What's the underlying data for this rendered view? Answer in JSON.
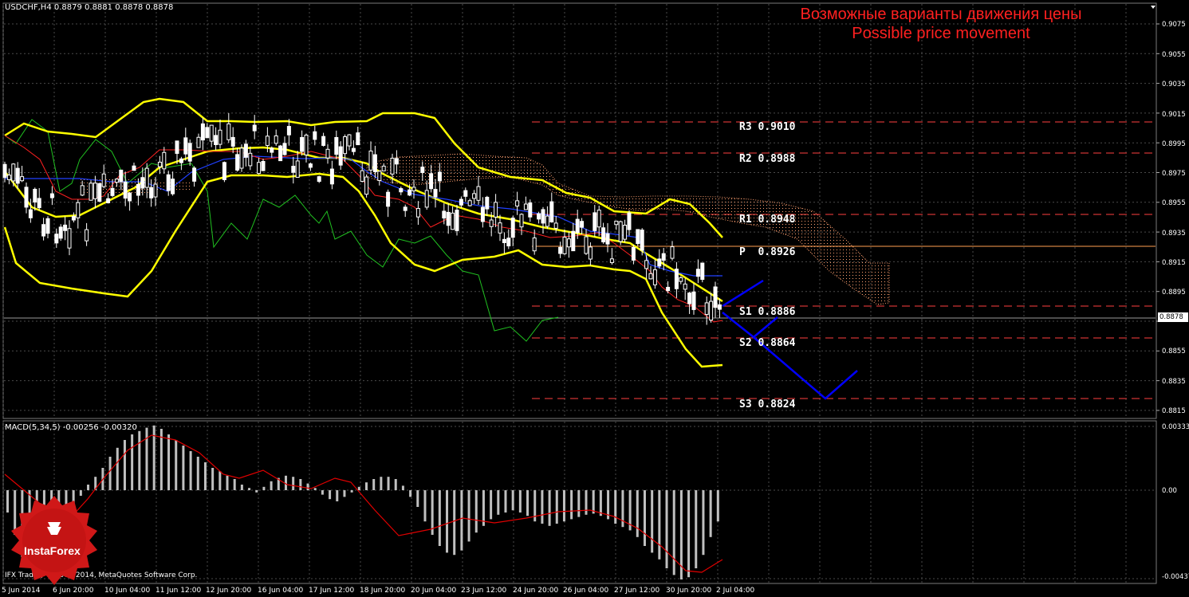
{
  "window": {
    "symbol_line": "USDCHF,H4  0.8879 0.8881 0.8878 0.8878",
    "banner_ru": "Возможные варианты движения цены",
    "banner_en": "Possible price movement",
    "macd_line": "MACD(5,34,5) -0.00256 -0.00320",
    "copyright": "IFX Trader, © 2001-2014, MetaQuotes Software Corp.",
    "logo_text": "InstaForex",
    "current_price": "0.8878"
  },
  "price_axis": [
    "0.9075",
    "0.9055",
    "0.9035",
    "0.9015",
    "0.8995",
    "0.8975",
    "0.8955",
    "0.8935",
    "0.8915",
    "0.8895",
    "0.8875",
    "0.8855",
    "0.8835",
    "0.8815"
  ],
  "macd_axis": [
    "0.00333",
    "0.00",
    "-0.00437"
  ],
  "date_axis": [
    "5 Jun 2014",
    "6 Jun 20:00",
    "10 Jun 04:00",
    "11 Jun 12:00",
    "12 Jun 20:00",
    "16 Jun 04:00",
    "17 Jun 12:00",
    "18 Jun 20:00",
    "20 Jun 04:00",
    "23 Jun 12:00",
    "24 Jun 20:00",
    "26 Jun 04:00",
    "27 Jun 12:00",
    "30 Jun 20:00",
    "2 Jul 04:00"
  ],
  "pivots": [
    {
      "label": "R3",
      "value": "0.9010",
      "color": "#ff4040",
      "style": "dashed"
    },
    {
      "label": "R2",
      "value": "0.8988",
      "color": "#ff4040",
      "style": "dashed"
    },
    {
      "label": "R1",
      "value": "0.8948",
      "color": "#ff4040",
      "style": "dashed"
    },
    {
      "label": "P",
      "value": "0.8926",
      "color": "#ffa050",
      "style": "solid"
    },
    {
      "label": "S1",
      "value": "0.8886",
      "color": "#ff4040",
      "style": "dashed"
    },
    {
      "label": "S2",
      "value": "0.8864",
      "color": "#ff4040",
      "style": "dashed"
    },
    {
      "label": "S3",
      "value": "0.8824",
      "color": "#ff4040",
      "style": "dashed"
    }
  ],
  "colors": {
    "background": "#000000",
    "grid": "#4a4a4a",
    "bollinger": "#ffff00",
    "tenkan": "#ff2020",
    "kijun": "#2040ff",
    "chikou": "#20c020",
    "kumo": "#ffa070",
    "forecast": "#0000ff",
    "candle": "#ffffff",
    "macd_hist": "#c0c0c0",
    "macd_signal": "#e00000"
  }
}
